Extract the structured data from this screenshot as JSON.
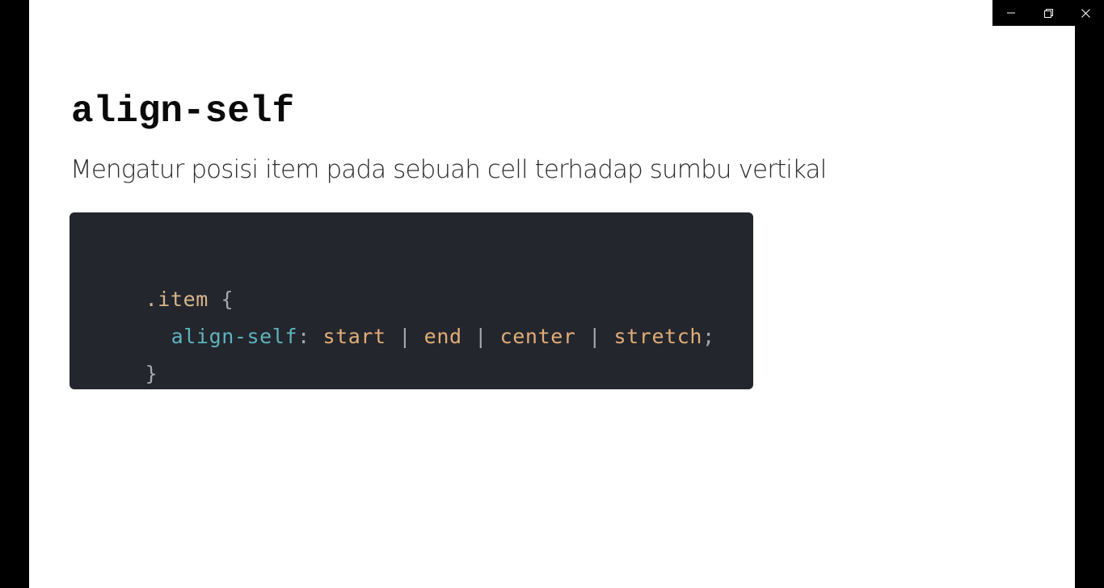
{
  "window": {
    "minimize_icon": "minimize-icon",
    "restore_icon": "restore-icon",
    "close_icon": "close-icon"
  },
  "slide": {
    "title": "align-self",
    "subtitle": "Mengatur posisi item pada sebuah cell terhadap sumbu vertikal",
    "code": {
      "selector": ".item",
      "open_brace": "{",
      "property": "align-self",
      "colon": ":",
      "values": [
        "start",
        "end",
        "center",
        "stretch"
      ],
      "separator": "|",
      "semicolon": ";",
      "close_brace": "}"
    }
  },
  "colors": {
    "code_background": "#23262d",
    "selector": "#d9b68a",
    "property": "#5fb3bf",
    "value": "#e2ad77",
    "punctuation": "#a7a9ae"
  }
}
